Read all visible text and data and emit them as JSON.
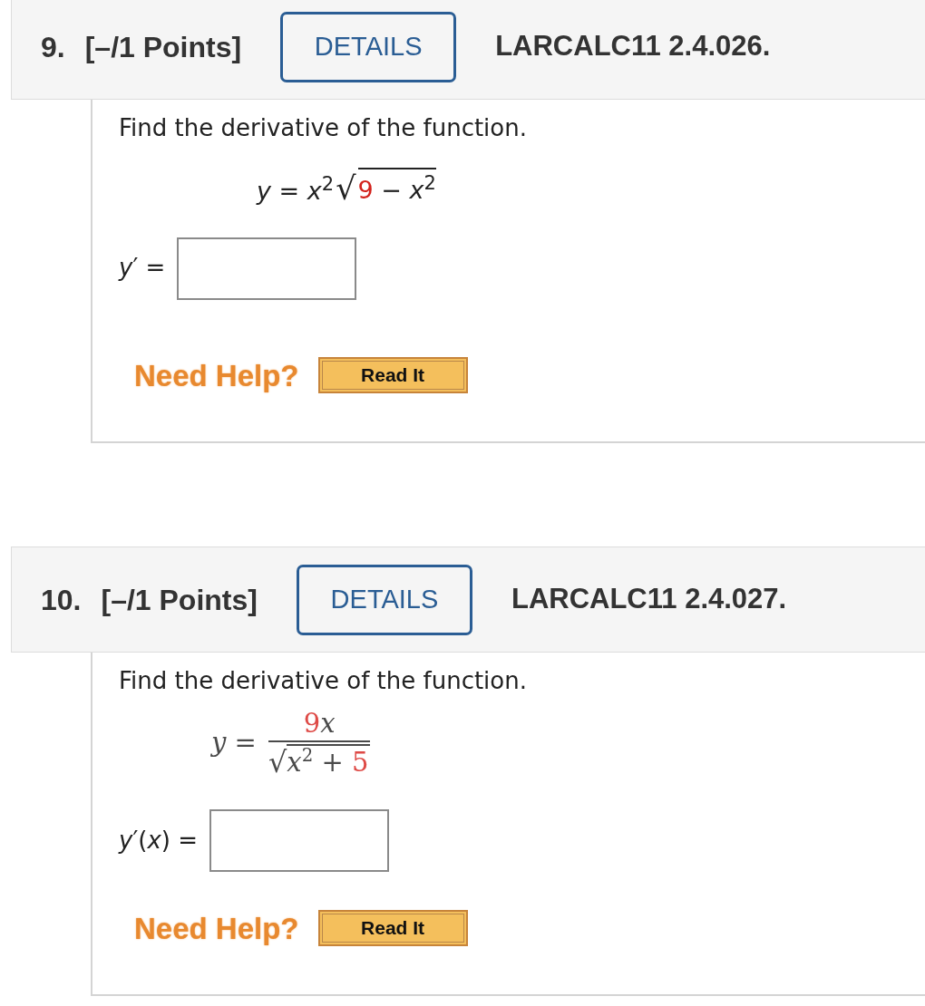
{
  "questions": [
    {
      "number": "9.",
      "points": "[–/1 Points]",
      "details_button": "DETAILS",
      "reference": "LARCALC11 2.4.026.",
      "prompt": "Find the derivative of the function.",
      "formula": {
        "kind": "inline",
        "tokens": [
          {
            "kind": "text",
            "text": "*y* = *x*",
            "highlight": false
          },
          {
            "kind": "sup",
            "text": "2",
            "highlight": false
          },
          {
            "kind": "root",
            "symbol": "√",
            "tokens": [
              {
                "kind": "text",
                "text": "9",
                "highlight": true
              },
              {
                "kind": "text",
                "text": " − *x*",
                "highlight": false
              },
              {
                "kind": "sup",
                "text": "2",
                "highlight": false
              }
            ]
          }
        ]
      },
      "answer_label": "*y*′ =",
      "help_label": "Need Help?",
      "help_button": "Read It"
    },
    {
      "number": "10.",
      "points": "[–/1 Points]",
      "details_button": "DETAILS",
      "reference": "LARCALC11 2.4.027.",
      "prompt": "Find the derivative of the function.",
      "formula": {
        "kind": "display",
        "tokens": [
          {
            "kind": "text",
            "text": "*y* =",
            "highlight": false
          },
          {
            "kind": "fraction",
            "numerator": [
              {
                "kind": "text",
                "text": "9",
                "highlight": true
              },
              {
                "kind": "text",
                "text": "*x*",
                "highlight": false
              }
            ],
            "denominator": [
              {
                "kind": "root",
                "symbol": "√",
                "tokens": [
                  {
                    "kind": "text",
                    "text": "*x*",
                    "highlight": false
                  },
                  {
                    "kind": "sup",
                    "text": "2",
                    "highlight": false
                  },
                  {
                    "kind": "text",
                    "text": " + ",
                    "highlight": false
                  },
                  {
                    "kind": "text",
                    "text": "5",
                    "highlight": true
                  }
                ]
              }
            ]
          }
        ]
      },
      "answer_label": "*y*′(*x*) =",
      "help_label": "Need Help?",
      "help_button": "Read It"
    }
  ]
}
